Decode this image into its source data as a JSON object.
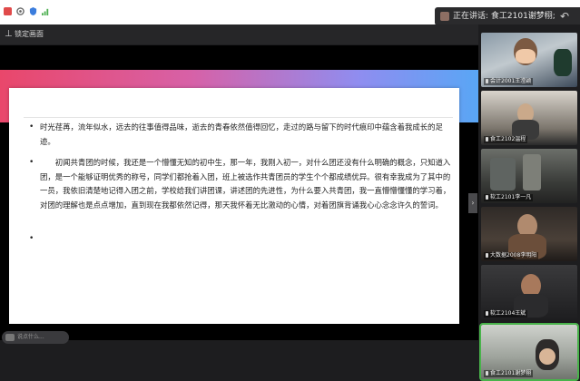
{
  "status_icons": [
    "app-icon",
    "settings-icon",
    "shield-icon",
    "signal-icon"
  ],
  "speaking_indicator": {
    "text": "正在讲话: 食工2101谢梦栩;"
  },
  "pin_bar": {
    "label": "锁定画面"
  },
  "slide": {
    "paragraphs": [
      "时光荏苒，流年似水，远去的往事值得品味，逝去的青春依然值得回忆，走过的路与留下的时代痕印中蕴含着我成长的足迹。",
      "初闻共青团的时候，我还是一个懵懂无知的初中生，那一年，我刚入初一，对什么团还没有什么明确的概念，只知道入团，是一个能够证明优秀的称号，同学们都抢着入团，班上被选作共青团员的学生个个都成绩优异。很有幸我成为了其中的一员，我依旧清楚地记得入团之前，学校给我们讲团课，讲述团的先进性，为什么要入共青团，我一直懵懵懂懂的学习着，对团的理解也是点点增加，直到现在我都依然记得，那天我怀着无比激动的心情，对着团旗背诵我心心念念许久的誓词。",
      ""
    ]
  },
  "chat_hint": {
    "text": "说点什么..."
  },
  "participants": [
    {
      "name": "会计2001王滢颖",
      "active": false
    },
    {
      "name": "食工2102温程",
      "active": false
    },
    {
      "name": "软工2101李一凡",
      "active": false
    },
    {
      "name": "大数据2008李明阳",
      "active": false
    },
    {
      "name": "软工2104王斌",
      "active": false
    },
    {
      "name": "食工2101谢梦栩",
      "active": true
    }
  ],
  "colors": {
    "band_start": "#e9476b",
    "band_end": "#59a6f5",
    "active_speaker": "#49b34b"
  }
}
